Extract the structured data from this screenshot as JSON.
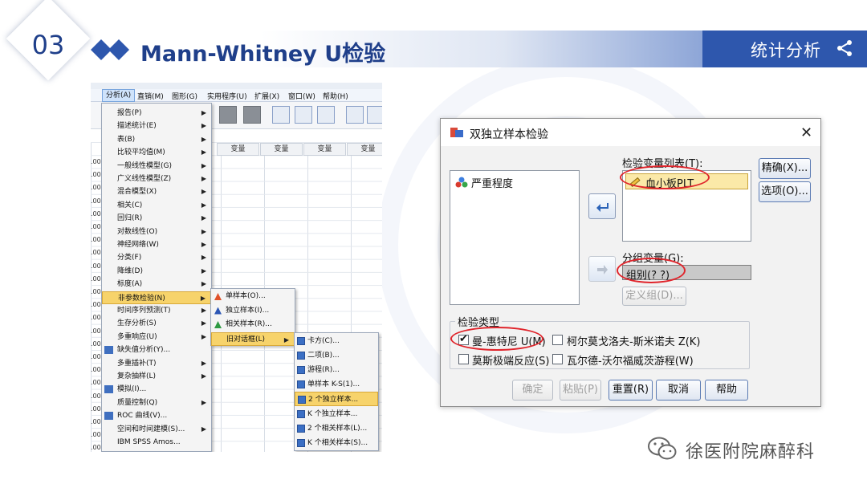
{
  "header": {
    "section_number": "03",
    "title": "Mann-Whitney U检验",
    "tab_label": "统计分析"
  },
  "spss": {
    "menubar": [
      "分析(A)",
      "直销(M)",
      "图形(G)",
      "实用程序(U)",
      "扩展(X)",
      "窗口(W)",
      "帮助(H)"
    ],
    "column_headers": [
      "变量",
      "变量",
      "变量",
      "变量"
    ],
    "row_prefix": ".00",
    "analyze_menu": [
      {
        "label": "报告(P)",
        "submenu": true
      },
      {
        "label": "描述统计(E)",
        "submenu": true
      },
      {
        "label": "表(B)",
        "submenu": true
      },
      {
        "label": "比较平均值(M)",
        "submenu": true
      },
      {
        "label": "一般线性模型(G)",
        "submenu": true
      },
      {
        "label": "广义线性模型(Z)",
        "submenu": true
      },
      {
        "label": "混合模型(X)",
        "submenu": true
      },
      {
        "label": "相关(C)",
        "submenu": true
      },
      {
        "label": "回归(R)",
        "submenu": true
      },
      {
        "label": "对数线性(O)",
        "submenu": true
      },
      {
        "label": "神经网络(W)",
        "submenu": true
      },
      {
        "label": "分类(F)",
        "submenu": true
      },
      {
        "label": "降维(D)",
        "submenu": true
      },
      {
        "label": "标度(A)",
        "submenu": true
      },
      {
        "label": "非参数检验(N)",
        "submenu": true,
        "highlighted": true
      },
      {
        "label": "时间序列预测(T)",
        "submenu": true
      },
      {
        "label": "生存分析(S)",
        "submenu": true
      },
      {
        "label": "多重响应(U)",
        "submenu": true
      },
      {
        "label": "缺失值分析(Y)...",
        "submenu": false,
        "icon": true
      },
      {
        "label": "多重插补(T)",
        "submenu": true
      },
      {
        "label": "复杂抽样(L)",
        "submenu": true
      },
      {
        "label": "模拟(I)...",
        "submenu": false,
        "icon": true
      },
      {
        "label": "质量控制(Q)",
        "submenu": true
      },
      {
        "label": "ROC 曲线(V)...",
        "submenu": false,
        "icon": true
      },
      {
        "label": "空间和时间建模(S)...",
        "submenu": true
      },
      {
        "label": "IBM SPSS Amos...",
        "submenu": false
      }
    ],
    "nonparam_menu": [
      {
        "label": "单样本(O)...",
        "color": "#e0522a"
      },
      {
        "label": "独立样本(I)...",
        "color": "#2b56b5"
      },
      {
        "label": "相关样本(R)...",
        "color": "#2e9a43"
      },
      {
        "label": "旧对话框(L)",
        "submenu": true,
        "highlighted": true
      }
    ],
    "legacy_menu": [
      {
        "label": "卡方(C)..."
      },
      {
        "label": "二项(B)..."
      },
      {
        "label": "游程(R)..."
      },
      {
        "label": "单样本 K-S(1)..."
      },
      {
        "label": "2 个独立样本...",
        "highlighted": true
      },
      {
        "label": "K 个独立样本..."
      },
      {
        "label": "2 个相关样本(L)..."
      },
      {
        "label": "K 个相关样本(S)..."
      }
    ]
  },
  "dialog": {
    "title": "双独立样本检验",
    "close": "✕",
    "source_list": [
      "严重程度"
    ],
    "test_var_label": "检验变量列表(T):",
    "test_vars": [
      "血小板PLT"
    ],
    "group_var_label": "分组变量(G):",
    "group_var_value": "组别(? ?)",
    "define_groups": "定义组(D)...",
    "exact_button": "精确(X)...",
    "options_button": "选项(O)...",
    "test_type_label": "检验类型",
    "tests": [
      {
        "label": "曼-惠特尼 U(M)",
        "checked": true
      },
      {
        "label": "柯尔莫戈洛夫-斯米诺夫 Z(K)",
        "checked": false
      },
      {
        "label": "莫斯极端反应(S)",
        "checked": false
      },
      {
        "label": "瓦尔德-沃尔福威茨游程(W)",
        "checked": false
      }
    ],
    "buttons": {
      "ok": "确定",
      "paste": "粘贴(P)",
      "reset": "重置(R)",
      "cancel": "取消",
      "help": "帮助"
    }
  },
  "footer": {
    "account": "徐医附院麻醉科"
  },
  "colors": {
    "brand_blue": "#2e57ad",
    "title_blue": "#1f3f8a",
    "highlight": "#e0242b",
    "menu_highlight": "#f7d36b"
  }
}
